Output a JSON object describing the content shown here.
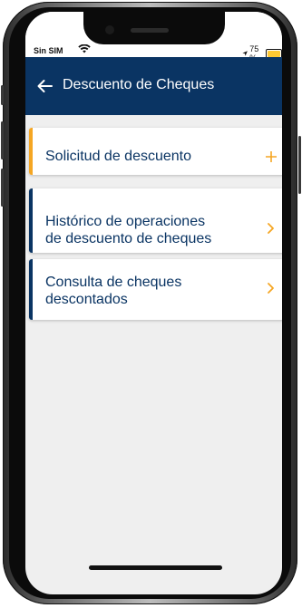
{
  "status_bar": {
    "carrier": "Sin SIM",
    "battery_text": "75 %",
    "battery_level": 0.75,
    "battery_color": "#ffc933"
  },
  "app_bar": {
    "title": "Descuento de Cheques",
    "back_icon": "arrow-left-icon",
    "background": "#0a3463"
  },
  "menu": {
    "accent_colors": {
      "active": "#f5a623",
      "inactive": "#0a3463"
    },
    "items": [
      {
        "label_lines": [
          "Solicitud de descuento"
        ],
        "trailing_icon": "plus-icon",
        "active": true
      },
      {
        "label_lines": [
          "Histórico de operaciones",
          "de descuento de cheques"
        ],
        "trailing_icon": "chevron-right-icon",
        "active": false
      },
      {
        "label_lines": [
          "Consulta de cheques",
          "descontados"
        ],
        "trailing_icon": "chevron-right-icon",
        "active": false
      }
    ]
  }
}
